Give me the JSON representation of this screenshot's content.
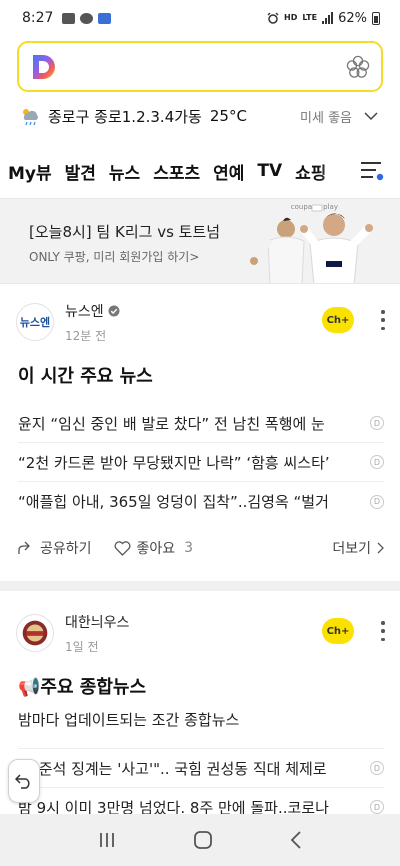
{
  "status": {
    "time": "8:27",
    "battery": "62%",
    "network": "LTE"
  },
  "search": {
    "placeholder": ""
  },
  "weather": {
    "location": "종로구 종로1.2.3.4가동",
    "temp": "25°C",
    "dust": "미세 좋음"
  },
  "tabs": [
    "My뷰",
    "발견",
    "뉴스",
    "스포츠",
    "연예",
    "TV",
    "쇼핑"
  ],
  "banner": {
    "title": "[오늘8시] 팀 K리그 vs 토트넘",
    "subtitle": "ONLY 쿠팡, 미리 회원가입 하기>",
    "brand": "coupang play"
  },
  "card1": {
    "publisher": "뉴스엔",
    "logo_text": "뉴스엔",
    "time": "12분 전",
    "channel_label": "Ch+",
    "title": "이 시간 주요 뉴스",
    "items": [
      "윤지 “임신 중인 배 발로 찼다” 전 남친 폭행에 눈",
      "“2천 카드론 받아 무당됐지만 나락” ‘함흥 씨스타’",
      "“애플힙 아내, 365일 엉덩이 집착”..김영옥 “벌거"
    ],
    "share": "공유하기",
    "like": "좋아요",
    "like_count": "3",
    "more": "더보기"
  },
  "card2": {
    "publisher": "대한늬우스",
    "time": "1일 전",
    "channel_label": "Ch+",
    "title": "📢주요 종합뉴스",
    "subtitle": "밤마다 업데이트되는 조간 종합뉴스",
    "items": [
      "\"이준석 징계는 '사고'\".. 국힘 권성동 직대 체제로",
      "밤 9시 이미 3만명 넘었다. 8주 만에 돌파..코로나"
    ]
  },
  "colors": {
    "accent": "#fae100",
    "search_border": "#f5dc2a"
  }
}
